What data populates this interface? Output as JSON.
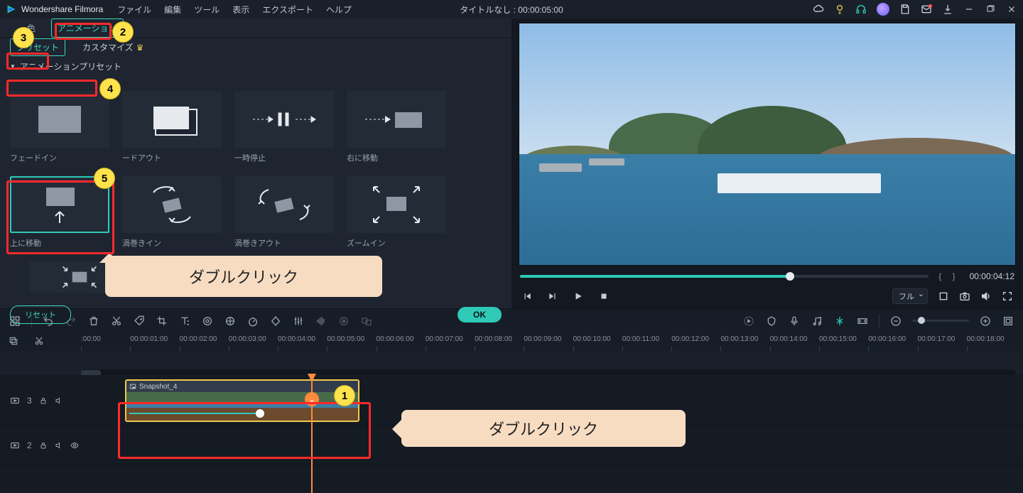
{
  "app": {
    "title": "Wondershare Filmora"
  },
  "menu": [
    "ファイル",
    "編集",
    "ツール",
    "表示",
    "エクスポート",
    "ヘルプ"
  ],
  "title_center": "タイトルなし : 00:00:05:00",
  "prop_tabs": {
    "color": "色",
    "animation": "アニメーション"
  },
  "sub_tabs": {
    "preset": "プリセット",
    "custom": "カスタマイズ"
  },
  "section": {
    "anim_preset": "アニメーションプリセット"
  },
  "presets": [
    {
      "label": "フェードイン"
    },
    {
      "label": "ードアウト"
    },
    {
      "label": "一時停止"
    },
    {
      "label": "右に移動"
    },
    {
      "label": "上に移動"
    },
    {
      "label": "渦巻きイン"
    },
    {
      "label": "渦巻きアウト"
    },
    {
      "label": "ズームイン"
    }
  ],
  "buttons": {
    "reset": "リセット",
    "ok": "OK"
  },
  "preview": {
    "time": "00:00:04:12",
    "quality": "フル"
  },
  "ruler_start": ":00:00",
  "ruler": [
    "00:00:01:00",
    "00:00:02:00",
    "00:00:03:00",
    "00:00:04:00",
    "00:00:05:00",
    "00:00:06:00",
    "00:00:07:00",
    "00:00:08:00",
    "00:00:09:00",
    "00:00:10:00",
    "00:00:11:00",
    "00:00:12:00",
    "00:00:13:00",
    "00:00:14:00",
    "00:00:15:00",
    "00:00:16:00",
    "00:00:17:00",
    "00:00:18:00"
  ],
  "clip": {
    "name": "Snapshot_4"
  },
  "track3": "3",
  "track2": "2",
  "callouts": {
    "dbl1": "ダブルクリック",
    "dbl2": "ダブルクリック"
  },
  "badges": {
    "b1": "1",
    "b2": "2",
    "b3": "3",
    "b4": "4",
    "b5": "5"
  }
}
